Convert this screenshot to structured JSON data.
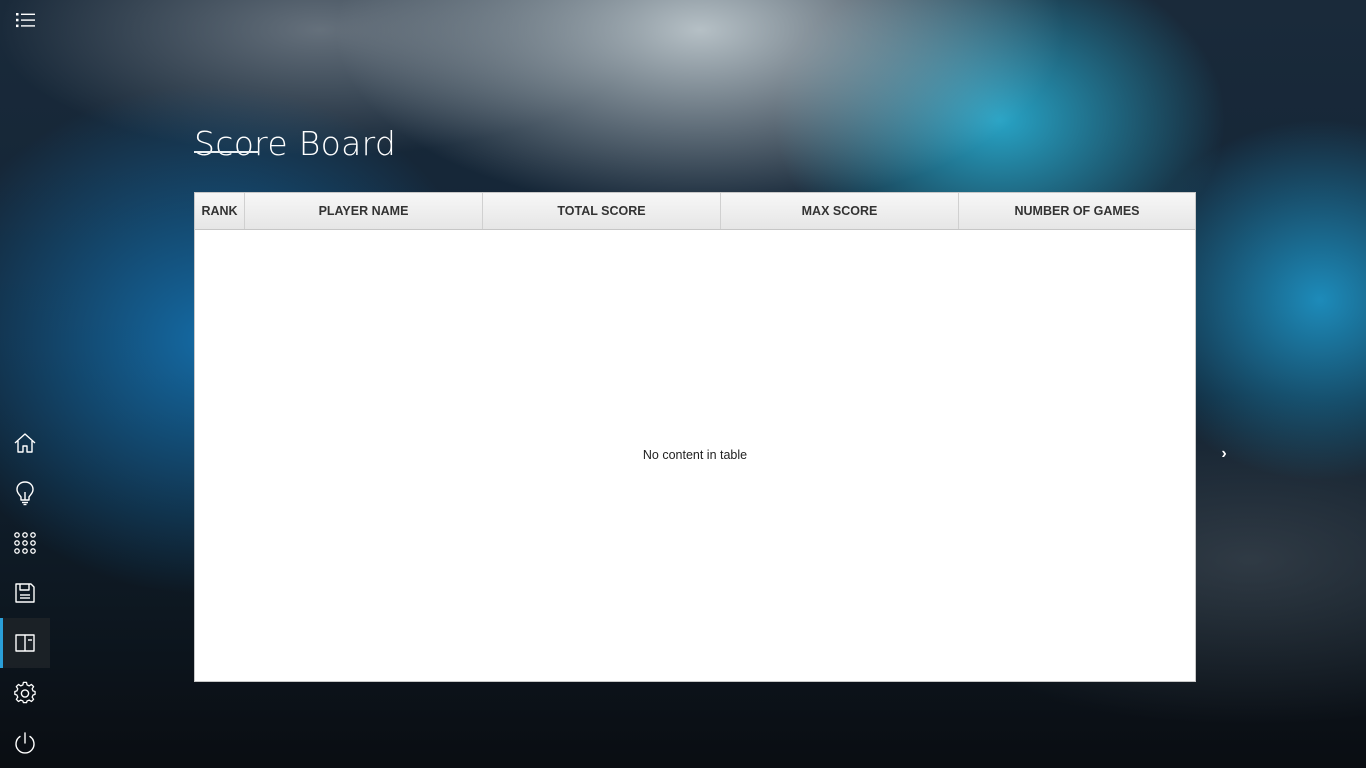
{
  "header": {
    "menu_icon": "list-menu-icon",
    "title": "Score Board"
  },
  "sidebar": {
    "items": [
      {
        "icon": "home-icon",
        "active": false
      },
      {
        "icon": "lightbulb-icon",
        "active": false
      },
      {
        "icon": "grid-icon",
        "active": false
      },
      {
        "icon": "save-icon",
        "active": false
      },
      {
        "icon": "scoreboard-icon",
        "active": true
      },
      {
        "icon": "gear-icon",
        "active": false
      },
      {
        "icon": "power-icon",
        "active": false
      }
    ]
  },
  "table": {
    "columns": [
      "RANK",
      "PLAYER NAME",
      "TOTAL SCORE",
      "MAX SCORE",
      "NUMBER OF GAMES"
    ],
    "rows": [],
    "empty_message": "No content in table"
  },
  "pager": {
    "next_glyph": "›",
    "next_icon": "chevron-right-icon"
  },
  "colors": {
    "accent": "#2a9fd8",
    "header_bg": "#ededed",
    "table_bg": "#ffffff"
  }
}
